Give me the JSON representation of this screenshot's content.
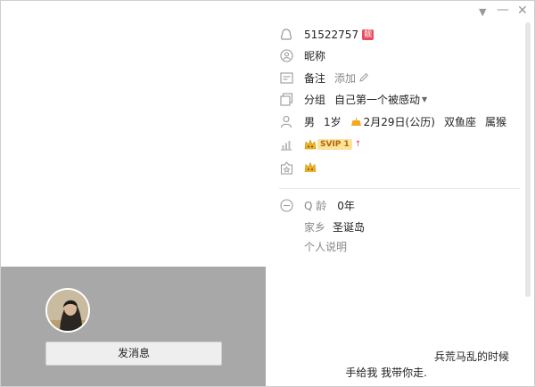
{
  "window": {
    "menu_icon": "chevron-down-icon",
    "minimize_icon": "minimize-icon",
    "close_icon": "close-icon"
  },
  "profile": {
    "qq_number": "51522757",
    "badge": "靓",
    "nickname_label": "昵称",
    "remark_label": "备注",
    "remark_add": "添加",
    "group_label": "分组",
    "group_value": "自己第一个被感动",
    "gender": "男",
    "age": "1岁",
    "birthday": "2月29日(公历)",
    "zodiac": "双鱼座",
    "chinese_zodiac": "属猴",
    "vip": "SVIP 1",
    "qage_label": "Q 龄",
    "qage_value": "0年",
    "hometown_label": "家乡",
    "hometown_value": "圣诞岛",
    "bio_label": "个人说明",
    "signature_line1": "兵荒马乱的时候",
    "signature_line2": "手给我 我带你走."
  },
  "actions": {
    "send_message": "发消息"
  },
  "colors": {
    "badge": "#e84a5f",
    "vip_bg": "#fbe39a",
    "panel_gray": "#a8a8a8"
  }
}
